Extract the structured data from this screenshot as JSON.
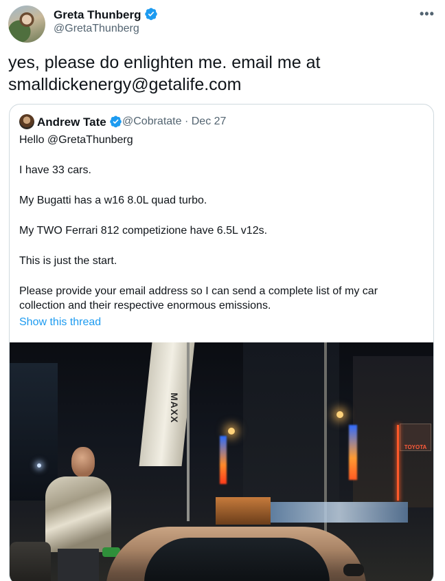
{
  "tweet": {
    "author_name": "Greta Thunberg",
    "author_handle": "@GretaThunberg",
    "more_icon": "more-icon",
    "verified_icon": "verified-badge-icon",
    "text_line1": "yes, please do enlighten me. email me at",
    "text_line2": "smalldickenergy@getalife.com"
  },
  "quoted_tweet": {
    "author_name": "Andrew Tate",
    "author_handle": "@Cobratate",
    "separator": "·",
    "date": "Dec 27",
    "lines": [
      "Hello @GretaThunberg",
      "I have 33 cars.",
      "My Bugatti has a w16 8.0L quad turbo.",
      "My TWO Ferrari 812 competizione have 6.5L v12s.",
      "This is just the start.",
      "Please provide your email address so I can send a complete list of my car",
      "collection and their respective enormous emissions."
    ],
    "show_thread_label": "Show this thread",
    "photo_signs": {
      "banner_text": "MAXX",
      "dealer_sign": "TOYOTA"
    }
  },
  "colors": {
    "accent": "#1d9bf0",
    "text": "#0f1419",
    "secondary": "#536471",
    "border": "#cfd9de"
  }
}
